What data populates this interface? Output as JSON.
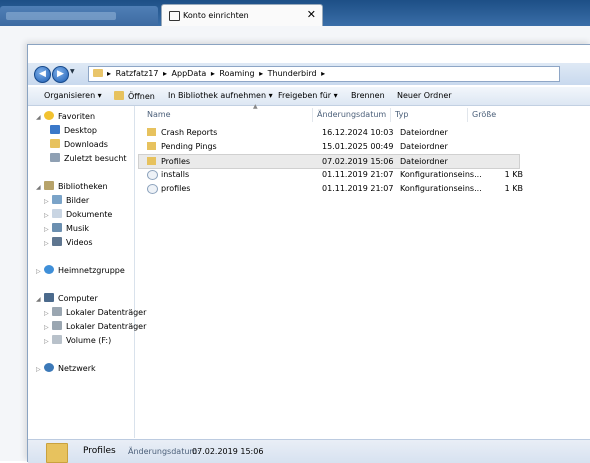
{
  "tabs": {
    "active_label": "Konto einrichten",
    "close_glyph": "✕"
  },
  "address": {
    "crumbs": [
      "Ratzfatz17",
      "AppData",
      "Roaming",
      "Thunderbird"
    ],
    "separator": "▸"
  },
  "toolbar": {
    "organize": "Organisieren ▾",
    "open": "Öffnen",
    "include": "In Bibliothek aufnehmen ▾",
    "share": "Freigeben für ▾",
    "burn": "Brennen",
    "new_folder": "Neuer Ordner"
  },
  "nav": {
    "favorites": "Favoriten",
    "desktop": "Desktop",
    "downloads": "Downloads",
    "recent": "Zuletzt besucht",
    "libraries": "Bibliotheken",
    "pictures": "Bilder",
    "documents": "Dokumente",
    "music": "Musik",
    "videos": "Videos",
    "homegroup": "Heimnetzgruppe",
    "computer": "Computer",
    "disk1": "Lokaler Datenträger",
    "disk2": "Lokaler Datenträger",
    "volume": "Volume (F:)",
    "network": "Netzwerk"
  },
  "columns": {
    "name": "Name",
    "date": "Änderungsdatum",
    "type": "Typ",
    "size": "Größe"
  },
  "files": [
    {
      "name": "Crash Reports",
      "date": "16.12.2024 10:03",
      "type": "Dateiordner",
      "size": "",
      "kind": "folder"
    },
    {
      "name": "Pending Pings",
      "date": "15.01.2025 00:49",
      "type": "Dateiordner",
      "size": "",
      "kind": "folder"
    },
    {
      "name": "Profiles",
      "date": "07.02.2019 15:06",
      "type": "Dateiordner",
      "size": "",
      "kind": "folder"
    },
    {
      "name": "installs",
      "date": "01.11.2019 21:07",
      "type": "Konfigurationseins...",
      "size": "1 KB",
      "kind": "config"
    },
    {
      "name": "profiles",
      "date": "01.11.2019 21:07",
      "type": "Konfigurationseins...",
      "size": "1 KB",
      "kind": "config"
    }
  ],
  "status": {
    "name": "Profiles",
    "date_label": "Änderungsdatum:",
    "date_value": "07.02.2019 15:06"
  },
  "colors": {
    "folder": "#e7c25e",
    "accent": "#1c5db3"
  }
}
